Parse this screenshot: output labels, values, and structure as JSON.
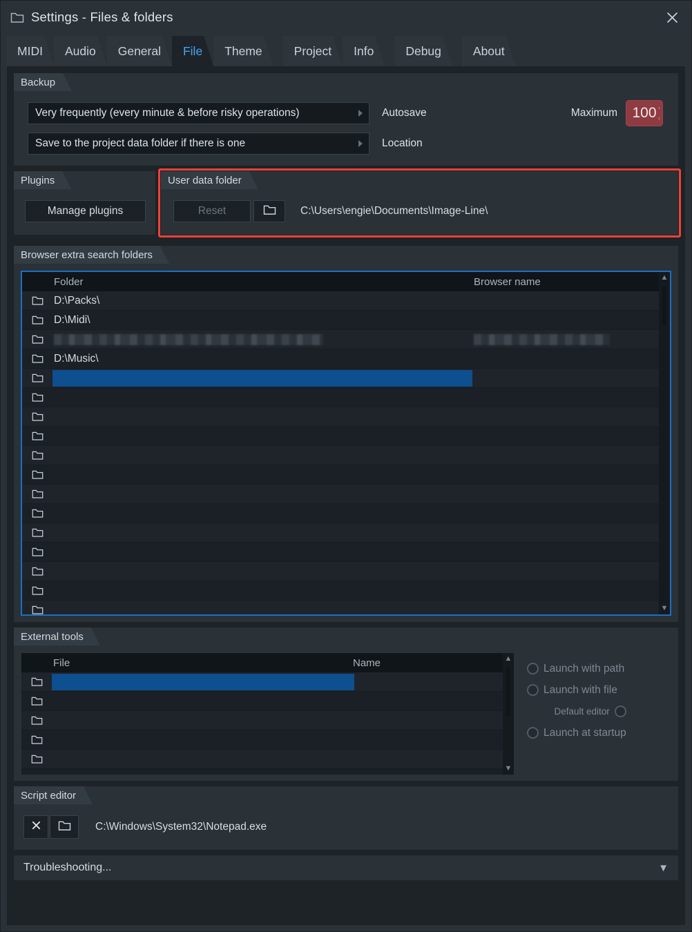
{
  "window": {
    "title": "Settings - Files & folders",
    "title_icon": "folder-icon",
    "close_icon": "close-icon"
  },
  "tabs": [
    {
      "label": "MIDI",
      "active": false
    },
    {
      "label": "Audio",
      "active": false
    },
    {
      "label": "General",
      "active": false
    },
    {
      "label": "File",
      "active": true
    },
    {
      "label": "Theme",
      "active": false
    },
    {
      "label": "Project",
      "active": false
    },
    {
      "label": "Info",
      "active": false
    },
    {
      "label": "Debug",
      "active": false
    },
    {
      "label": "About",
      "active": false
    }
  ],
  "backup": {
    "title": "Backup",
    "autosave": {
      "value": "Very frequently (every minute & before risky operations)",
      "label": "Autosave"
    },
    "location": {
      "value": "Save to the project data folder if there is one",
      "label": "Location"
    },
    "maximum": {
      "label": "Maximum",
      "value": "100"
    }
  },
  "plugins": {
    "title": "Plugins",
    "manage_label": "Manage plugins"
  },
  "user_data_folder": {
    "title": "User data folder",
    "reset_label": "Reset",
    "browse_icon": "folder-icon",
    "path": "C:\\Users\\engie\\Documents\\Image-Line\\",
    "highlight_color": "#ef4136"
  },
  "browser_folders": {
    "title": "Browser extra search folders",
    "columns": {
      "folder": "Folder",
      "browser_name": "Browser name"
    },
    "rows": [
      {
        "folder": "D:\\Packs\\",
        "name": "",
        "selected": false,
        "blurred": false
      },
      {
        "folder": "D:\\Midi\\",
        "name": "",
        "selected": false,
        "blurred": false
      },
      {
        "folder": "",
        "name": "",
        "selected": false,
        "blurred": true
      },
      {
        "folder": "D:\\Music\\",
        "name": "",
        "selected": false,
        "blurred": false
      },
      {
        "folder": "",
        "name": "",
        "selected": true,
        "blurred": false
      },
      {
        "folder": "",
        "name": "",
        "selected": false,
        "blurred": false
      },
      {
        "folder": "",
        "name": "",
        "selected": false,
        "blurred": false
      },
      {
        "folder": "",
        "name": "",
        "selected": false,
        "blurred": false
      },
      {
        "folder": "",
        "name": "",
        "selected": false,
        "blurred": false
      },
      {
        "folder": "",
        "name": "",
        "selected": false,
        "blurred": false
      },
      {
        "folder": "",
        "name": "",
        "selected": false,
        "blurred": false
      },
      {
        "folder": "",
        "name": "",
        "selected": false,
        "blurred": false
      },
      {
        "folder": "",
        "name": "",
        "selected": false,
        "blurred": false
      },
      {
        "folder": "",
        "name": "",
        "selected": false,
        "blurred": false
      },
      {
        "folder": "",
        "name": "",
        "selected": false,
        "blurred": false
      },
      {
        "folder": "",
        "name": "",
        "selected": false,
        "blurred": false
      },
      {
        "folder": "",
        "name": "",
        "selected": false,
        "blurred": false
      }
    ],
    "scroll_up_icon": "chevron-up-icon",
    "scroll_down_icon": "chevron-down-icon"
  },
  "external_tools": {
    "title": "External tools",
    "columns": {
      "file": "File",
      "name": "Name"
    },
    "rows": [
      {
        "file": "",
        "name": "",
        "selected": true
      },
      {
        "file": "",
        "name": "",
        "selected": false
      },
      {
        "file": "",
        "name": "",
        "selected": false
      },
      {
        "file": "",
        "name": "",
        "selected": false
      },
      {
        "file": "",
        "name": "",
        "selected": false
      }
    ],
    "options": [
      {
        "label": "Launch with path",
        "checked": false,
        "align": "left"
      },
      {
        "label": "Launch with file",
        "checked": false,
        "align": "left"
      },
      {
        "label": "Default editor",
        "checked": false,
        "align": "right"
      },
      {
        "label": "Launch at startup",
        "checked": false,
        "align": "left"
      }
    ]
  },
  "script_editor": {
    "title": "Script editor",
    "clear_icon": "close-x-icon",
    "browse_icon": "folder-icon",
    "path": "C:\\Windows\\System32\\Notepad.exe"
  },
  "troubleshooting": {
    "label": "Troubleshooting...",
    "expand_icon": "chevron-down-icon"
  }
}
